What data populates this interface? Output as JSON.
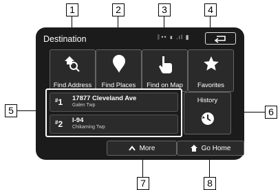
{
  "header": {
    "title": "Destination",
    "status": "ᛒ•• ▮ .ıl ▮"
  },
  "tiles": [
    {
      "label": "Find Address",
      "icon": "home-search-icon"
    },
    {
      "label": "Find Places",
      "icon": "map-pin-icon"
    },
    {
      "label": "Find on Map",
      "icon": "hand-pointer-icon"
    },
    {
      "label": "Favorites",
      "icon": "star-icon"
    }
  ],
  "recent": [
    {
      "index": "1",
      "address": "17877 Cleveland Ave",
      "city": "Galen Twp"
    },
    {
      "index": "2",
      "address": "I-94",
      "city": "Chikaming Twp"
    }
  ],
  "history": {
    "label": "History",
    "icon": "clock-history-icon"
  },
  "buttons": {
    "more": "More",
    "go_home": "Go Home"
  },
  "callouts": [
    "1",
    "2",
    "3",
    "4",
    "5",
    "6",
    "7",
    "8"
  ],
  "colors": {
    "screen_bg": "#1b1b1b",
    "tile_bg": "#2a2a2a",
    "text": "#ffffff",
    "highlight": "#ffffff"
  }
}
